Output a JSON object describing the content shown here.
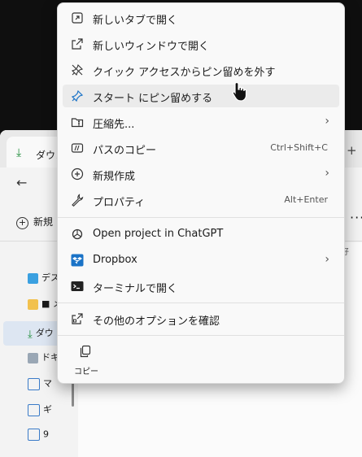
{
  "menu": {
    "items": [
      {
        "label": "新しいタブで開く",
        "icon": "open-new-tab-icon"
      },
      {
        "label": "新しいウィンドウで開く",
        "icon": "open-new-window-icon"
      },
      {
        "label": "クイック アクセスからピン留めを外す",
        "icon": "unpin-icon"
      },
      {
        "label": "スタート にピン留めする",
        "icon": "pin-icon"
      },
      {
        "label": "圧縮先...",
        "icon": "zip-folder-icon"
      },
      {
        "label": "パスのコピー",
        "icon": "copy-path-icon",
        "shortcut": "Ctrl+Shift+C"
      },
      {
        "label": "新規作成",
        "icon": "new-item-icon"
      },
      {
        "label": "プロパティ",
        "icon": "wrench-icon",
        "shortcut": "Alt+Enter"
      },
      {
        "label": "Open project in ChatGPT",
        "icon": "chatgpt-icon"
      },
      {
        "label": "Dropbox",
        "icon": "dropbox-icon"
      },
      {
        "label": "ターミナルで開く",
        "icon": "terminal-icon"
      },
      {
        "label": "その他のオプションを確認",
        "icon": "more-options-icon"
      }
    ],
    "copy_label": "コピー"
  },
  "explorer": {
    "tab_label": "ダウン",
    "toolbar_new": "新規",
    "sidebar": [
      "デス",
      "■ メ",
      "ダウ",
      "ドキ",
      "マ",
      "ギ",
      "9"
    ],
    "small_text": "好"
  },
  "colors": {
    "accent": "#1a73c7",
    "menu_bg": "#f9f9f9",
    "hover": "#ebebeb"
  }
}
